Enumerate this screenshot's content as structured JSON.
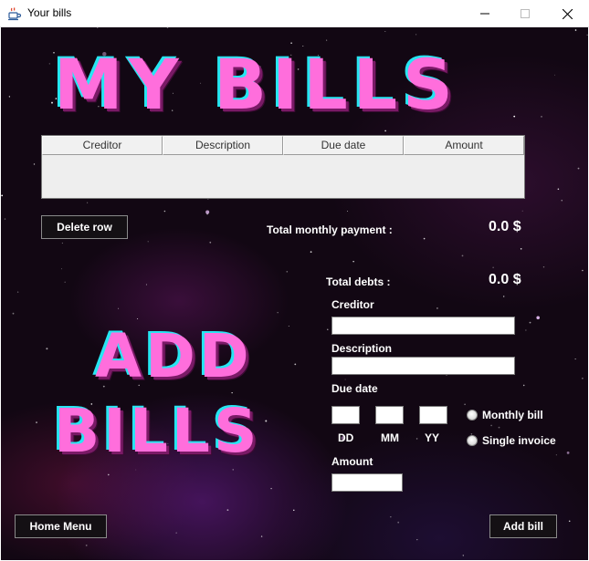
{
  "window": {
    "title": "Your bills",
    "icon": "java-cup-icon",
    "controls": [
      "minimize-icon",
      "maximize-icon",
      "close-icon"
    ]
  },
  "header": {
    "title": "MY BILLS"
  },
  "table": {
    "columns": [
      "Creditor",
      "Description",
      "Due date",
      "Amount"
    ],
    "rows": []
  },
  "summary": {
    "delete_label": "Delete row",
    "monthly_label": "Total monthly payment :",
    "monthly_value": "0.0 $",
    "debts_label": "Total debts :",
    "debts_value": "0.0 $"
  },
  "add_section": {
    "title_line1": "ADD",
    "title_line2": "BILLS"
  },
  "form": {
    "creditor_label": "Creditor",
    "creditor_value": "",
    "description_label": "Description",
    "description_value": "",
    "due_date_label": "Due date",
    "dd_label": "DD",
    "mm_label": "MM",
    "yy_label": "YY",
    "dd_value": "",
    "mm_value": "",
    "yy_value": "",
    "monthly_option": "Monthly bill",
    "single_option": "Single invoice",
    "amount_label": "Amount",
    "amount_value": ""
  },
  "footer": {
    "home_label": "Home Menu",
    "add_label": "Add bill"
  },
  "colors": {
    "title_fill": "#ff6edc",
    "title_outline": "#26e6f2",
    "background": "#120713"
  }
}
